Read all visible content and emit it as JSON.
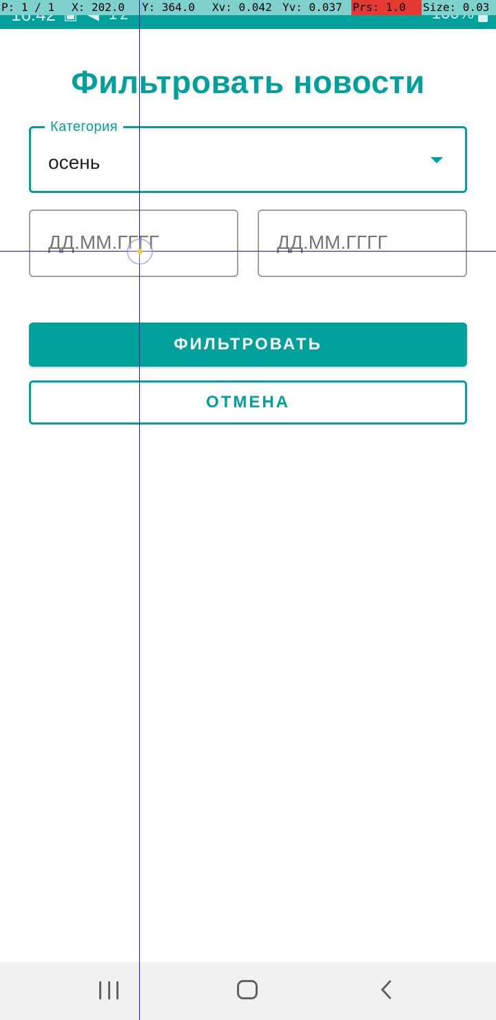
{
  "status_bar": {
    "time": "16:42",
    "left_icons": "▣ ◀ 12",
    "right_text": "100%",
    "icons": [
      "image-icon",
      "telegram-icon",
      "wifi-icon",
      "signal-icon",
      "battery-icon"
    ]
  },
  "pointer_info": {
    "p": "P: 1 / 1",
    "x": "X: 202.0",
    "y": "Y: 364.0",
    "xv": "Xv: 0.042",
    "yv": "Yv: 0.037",
    "prs": "Prs: 1.0",
    "size": "Size: 0.03"
  },
  "page": {
    "title": "Фильтровать новости"
  },
  "category": {
    "label": "Категория",
    "value": "осень"
  },
  "date_from": {
    "placeholder": "ДД.ММ.ГГГГ",
    "value": ""
  },
  "date_to": {
    "placeholder": "ДД.ММ.ГГГГ",
    "value": ""
  },
  "buttons": {
    "filter": "ФИЛЬТРОВАТЬ",
    "cancel": "ОТМЕНА"
  },
  "colors": {
    "accent": "#00a19a",
    "nav_bar": "#f1f1f1",
    "crosshair": "#1a1aa8"
  }
}
